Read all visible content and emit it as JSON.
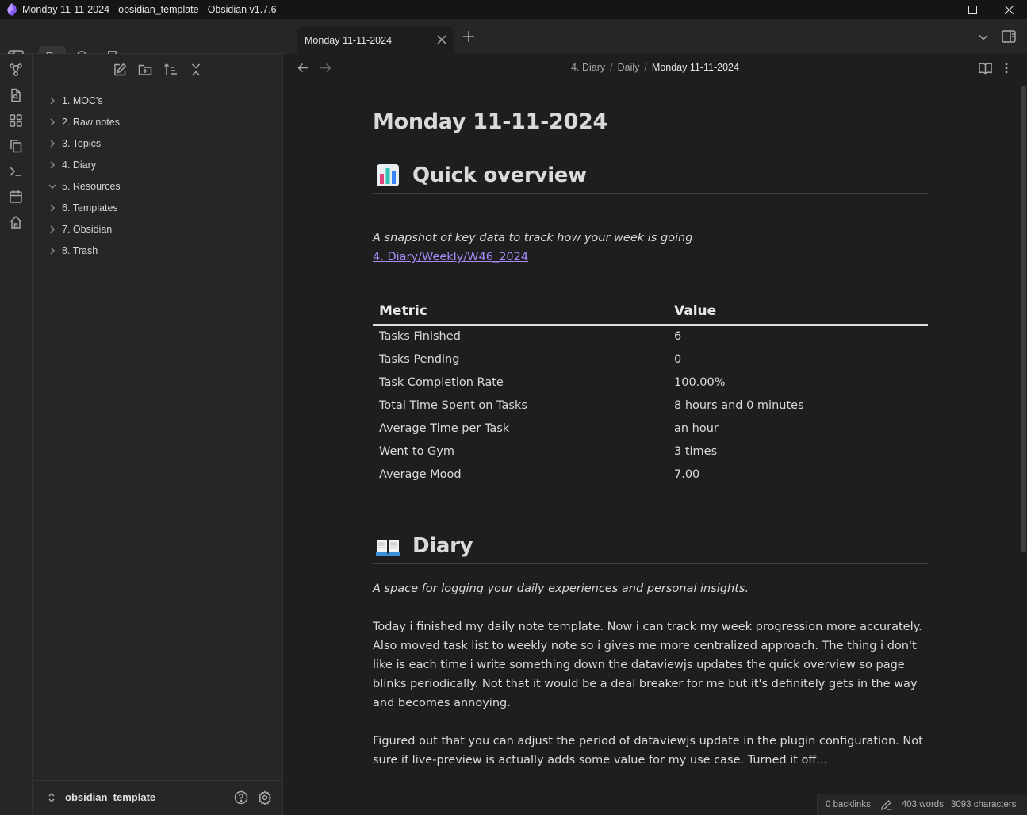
{
  "window": {
    "title": "Monday 11-11-2024 - obsidian_template - Obsidian v1.7.6"
  },
  "tab": {
    "label": "Monday 11-11-2024"
  },
  "breadcrumb": {
    "part1": "4. Diary",
    "part2": "Daily",
    "current": "Monday 11-11-2024",
    "separator": "/"
  },
  "explorer": {
    "items": [
      {
        "label": "1. MOC's",
        "expanded": false
      },
      {
        "label": "2. Raw notes",
        "expanded": false
      },
      {
        "label": "3. Topics",
        "expanded": false
      },
      {
        "label": "4. Diary",
        "expanded": false
      },
      {
        "label": "5. Resources",
        "expanded": true
      },
      {
        "label": "6. Templates",
        "expanded": false
      },
      {
        "label": "7. Obsidian",
        "expanded": false
      },
      {
        "label": "8. Trash",
        "expanded": false
      }
    ]
  },
  "vault": {
    "name": "obsidian_template"
  },
  "note": {
    "title": "Monday 11-11-2024",
    "quick_overview": {
      "heading": "Quick overview",
      "subtitle": "A snapshot of key data to track how your week is going",
      "link": "4. Diary/Weekly/W46_2024"
    },
    "table": {
      "headers": [
        "Metric",
        "Value"
      ],
      "rows": [
        [
          "Tasks Finished",
          "6"
        ],
        [
          "Tasks Pending",
          "0"
        ],
        [
          "Task Completion Rate",
          "100.00%"
        ],
        [
          "Total Time Spent on Tasks",
          "8 hours and 0 minutes"
        ],
        [
          "Average Time per Task",
          "an hour"
        ],
        [
          "Went to Gym",
          "3 times"
        ],
        [
          "Average Mood",
          "7.00"
        ]
      ]
    },
    "diary": {
      "heading": "Diary",
      "subtitle": "A space for logging your daily experiences and personal insights.",
      "paragraph1": "Today i finished my daily note template. Now i can track my week progression more accurately. Also moved task list to weekly note so i gives me more centralized approach.  The thing i don't like is each time i write something down the dataviewjs updates the quick overview so page blinks periodically. Not that it would be a deal breaker for me but it's definitely gets in the way and becomes annoying.",
      "paragraph2": "Figured out that you can adjust the period of dataviewjs update in the plugin configuration. Not sure if live-preview is actually adds some value for my use case. Turned it off..."
    }
  },
  "status": {
    "backlinks": "0 backlinks",
    "words": "403 words",
    "characters": "3093 characters"
  },
  "colors": {
    "accent": "#a88bfa",
    "background": "#1e1e1e",
    "sidebar": "#262626"
  },
  "icons": [
    "obsidian-logo",
    "minimize-icon",
    "maximize-icon",
    "close-icon",
    "sidebar-toggle-icon",
    "folder-icon",
    "search-icon",
    "bookmark-icon",
    "graph-icon",
    "file-search-icon",
    "blocks-icon",
    "copy-icon",
    "terminal-icon",
    "calendar-icon",
    "home-icon",
    "new-note-icon",
    "new-folder-icon",
    "sort-icon",
    "collapse-icon",
    "chevron-right-icon",
    "chevron-down-icon",
    "help-icon",
    "gear-icon",
    "arrow-left-icon",
    "arrow-right-icon",
    "book-open-icon",
    "more-vertical-icon",
    "pencil-icon",
    "bar-chart-emoji",
    "open-book-emoji"
  ]
}
